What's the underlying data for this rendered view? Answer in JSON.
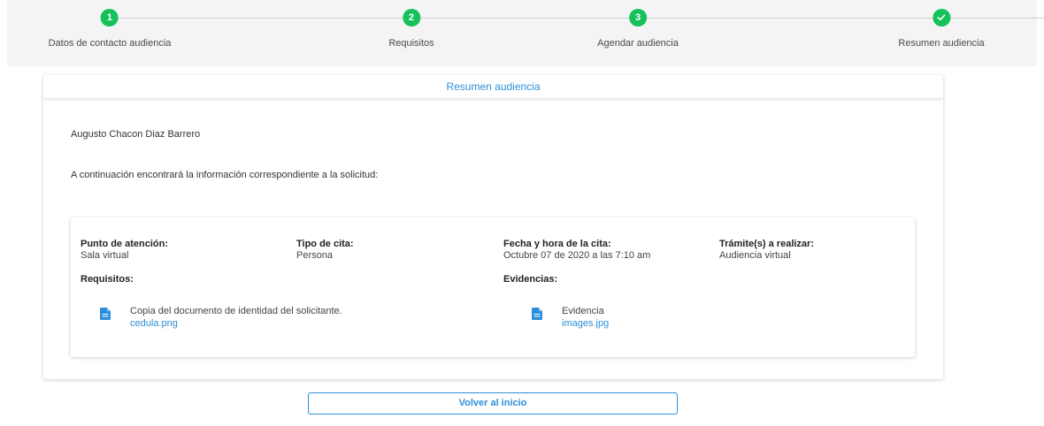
{
  "stepper": {
    "steps": [
      {
        "badge": "1",
        "label": "Datos de contacto audiencia"
      },
      {
        "badge": "2",
        "label": "Requisitos"
      },
      {
        "badge": "3",
        "label": "Agendar audiencia"
      },
      {
        "badge": "check-icon",
        "label": "Resumen audiencia"
      }
    ],
    "accent": "#14c15a"
  },
  "card": {
    "title": "Resumen audiencia",
    "name": "Augusto Chacon Diaz Barrero",
    "intro": "A continuación encontrará la información correspondiente a la solicitud:"
  },
  "details": {
    "punto_label": "Punto de atención:",
    "punto_value": "Sala virtual",
    "tipo_label": "Tipo de cita:",
    "tipo_value": "Persona",
    "fecha_label": "Fecha y hora de la cita:",
    "fecha_value": "Octubre 07 de 2020 a las 7:10 am",
    "tramite_label": "Trámite(s) a realizar:",
    "tramite_value": "Audiencia virtual",
    "requisitos_label": "Requisitos:",
    "evidencias_label": "Evidencias:",
    "requisito": {
      "icon": "document-icon",
      "title": "Copia del documento de identidad del solicitante.",
      "file": "cedula.png"
    },
    "evidencia": {
      "icon": "document-icon",
      "title": "Evidencia",
      "file": "images.jpg"
    }
  },
  "actions": {
    "back_label": "Volver al inicio"
  },
  "colors": {
    "link": "#2d8fd9",
    "step": "#14c15a"
  }
}
